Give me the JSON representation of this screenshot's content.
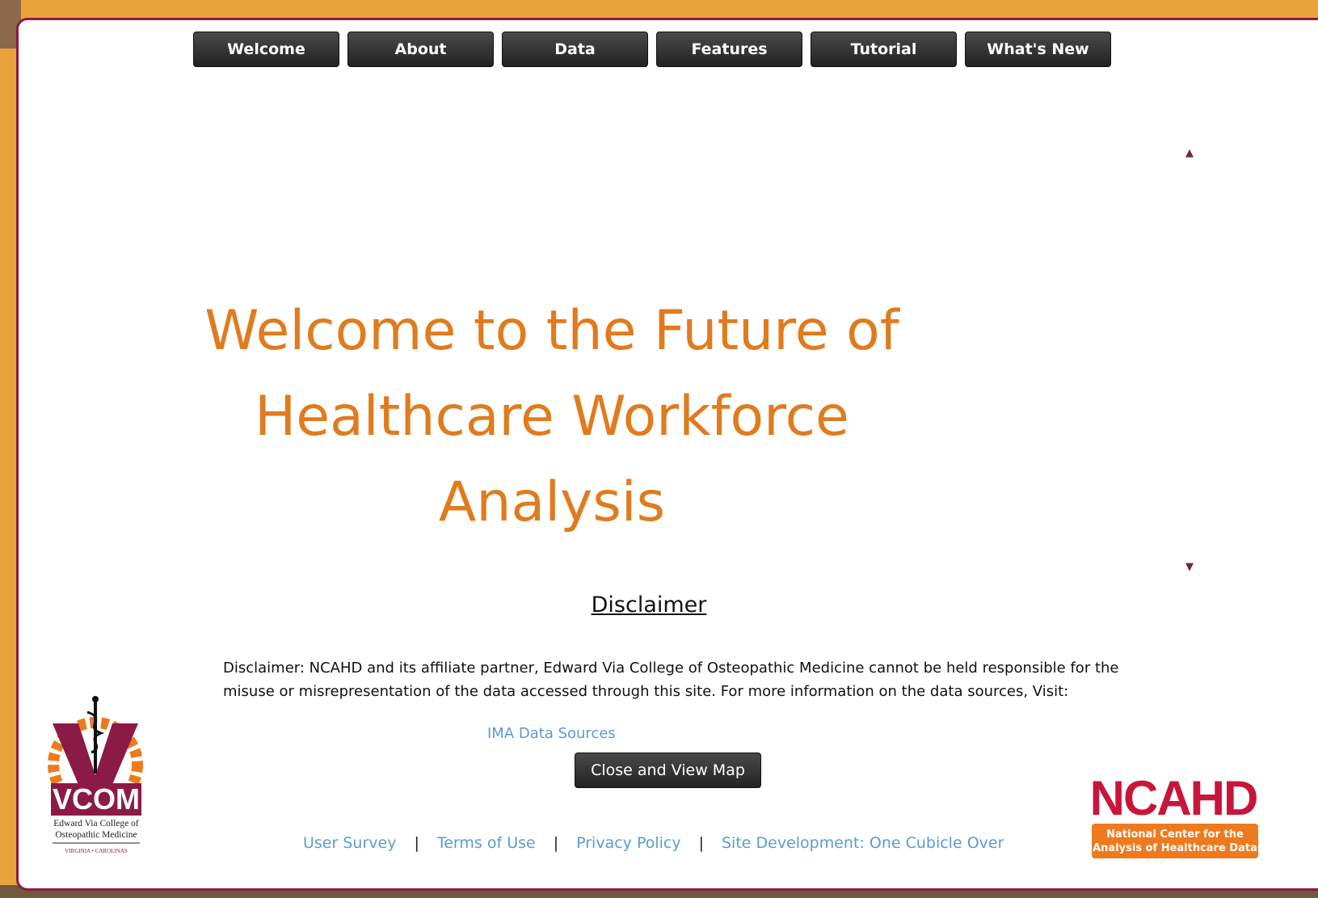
{
  "nav": {
    "items": [
      {
        "label": "Welcome"
      },
      {
        "label": "About"
      },
      {
        "label": "Data"
      },
      {
        "label": "Features"
      },
      {
        "label": "Tutorial"
      },
      {
        "label": "What's New"
      }
    ]
  },
  "scroll": {
    "up_icon": "triangle-up",
    "down_icon": "triangle-down"
  },
  "main": {
    "title_line1": "Welcome to the Future of",
    "title_line2": "Healthcare Workforce Analysis"
  },
  "disclaimer": {
    "heading": "Disclaimer",
    "text": "Disclaimer: NCAHD and its affiliate partner, Edward Via College of Osteopathic Medicine cannot be held responsible for the misuse or misrepresentation of the data accessed through this site.  For more information on the data sources,  Visit:",
    "link": "IMA Data Sources"
  },
  "close_button": "Close and View Map",
  "footer": {
    "links": [
      "User Survey",
      "Terms of Use",
      "Privacy Policy",
      "Site Development: One Cubicle Over"
    ],
    "separator": "|"
  },
  "vcom_logo": {
    "abbr": "VCOM",
    "line1": "Edward Via College of",
    "line2": "Osteopathic Medicine",
    "line3": "VIRGINIA • CAROLINAS"
  },
  "ncahd_logo": {
    "abbr": "NCAHD",
    "line1": "National Center for the",
    "line2": "Analysis of Healthcare Data"
  },
  "colors": {
    "accent_orange": "#e07b1e",
    "border_maroon": "#8c1a47",
    "link_blue": "#5b9bd5",
    "background_orange": "#e8a33a"
  }
}
